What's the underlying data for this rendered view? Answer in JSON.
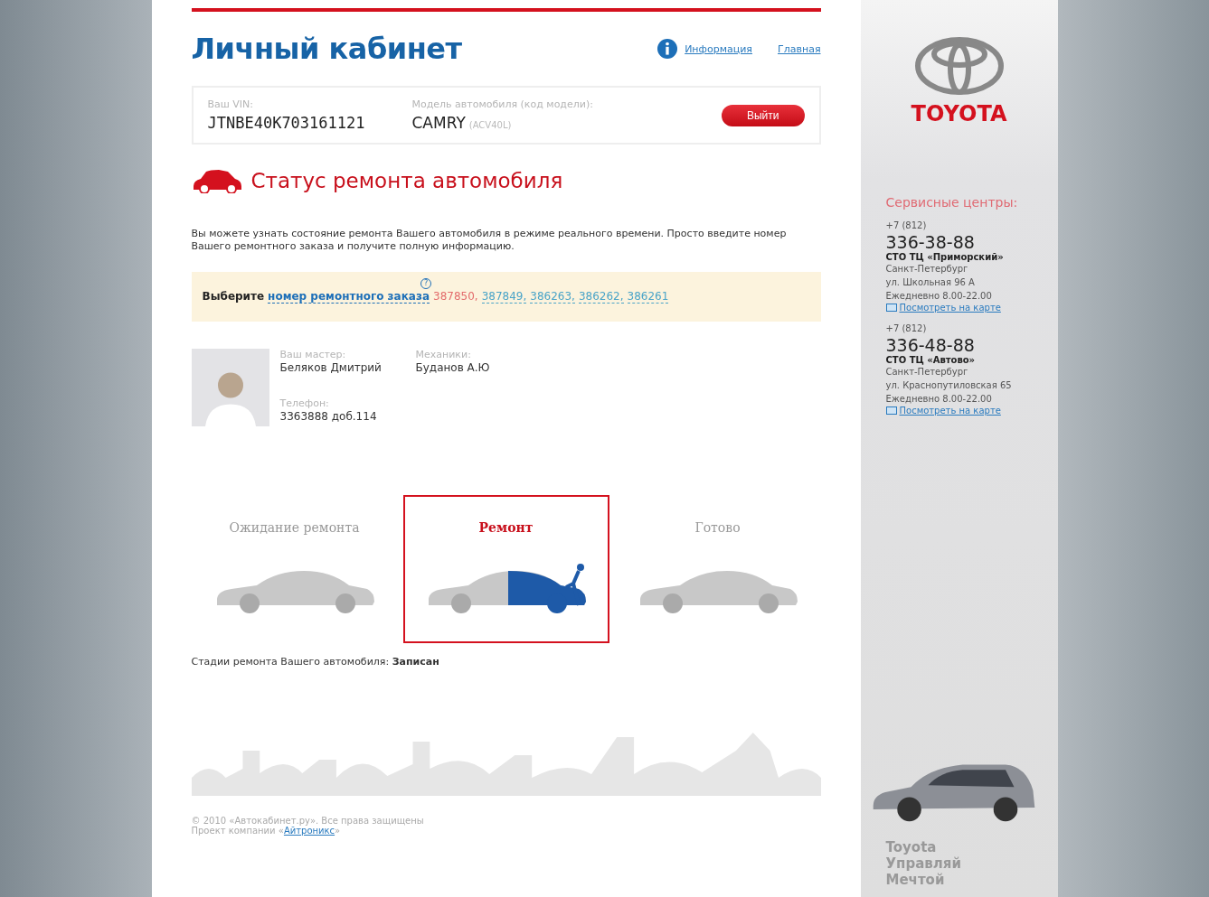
{
  "header": {
    "title": "Личный кабинет",
    "links": [
      {
        "kind": "info",
        "label": "Информация"
      },
      {
        "kind": "plain",
        "label": "Главная"
      }
    ]
  },
  "vehicle": {
    "vin_label": "Ваш VIN:",
    "vin": "JTNBE40K703161121",
    "model_label": "Модель автомобиля (код модели):",
    "model": "CAMRY",
    "model_code": "(ACV40L)",
    "logout_button": "Выйти"
  },
  "section_title": "Статус ремонта автомобиля",
  "description": "Вы можете узнать состояние ремонта Вашего автомобиля в режиме реального времени. Просто введите номер Вашего ремонтного заказа и получите полную информацию.",
  "order_selector": {
    "label": "Выберите",
    "link": "номер ремонтного заказа",
    "help": "?",
    "orders": [
      {
        "number": "387850,",
        "selected": true
      },
      {
        "number": "387849,",
        "selected": false
      },
      {
        "number": "386263,",
        "selected": false
      },
      {
        "number": "386262,",
        "selected": false
      },
      {
        "number": "386261",
        "selected": false
      }
    ]
  },
  "staff": {
    "master_label": "Ваш мастер:",
    "master": "Беляков Дмитрий",
    "mechanic_label": "Механики:",
    "mechanic": "Буданов А.Ю",
    "phone_label": "Телефон:",
    "phone": "3363888 доб.114"
  },
  "stages": [
    {
      "kind": "waiting",
      "label": "Ожидание ремонта",
      "selected": false
    },
    {
      "kind": "repair",
      "label": "Ремонт",
      "selected": true
    },
    {
      "kind": "done",
      "label": "Готово",
      "selected": false
    }
  ],
  "stage_status": {
    "label": "Стадии ремонта Вашего автомобиля:",
    "value": "Записан"
  },
  "footer": {
    "copyright": "© 2010 «Автокабинет.ру». Все права защищены",
    "project_prefix": "Проект компании «",
    "project_link": "Айтроникс",
    "project_suffix": "»"
  },
  "sidebar": {
    "brand": "TOYOTA",
    "service_title": "Сервисные центры:",
    "centers": [
      {
        "code": "+7 (812)",
        "phone": "336-38-88",
        "name": "СТО ТЦ «Приморский»",
        "city": "Санкт-Петербург",
        "street": "ул. Школьная 96 А",
        "hours": "Ежедневно 8.00-22.00",
        "map_link": "Посмотреть на карте"
      },
      {
        "code": "+7 (812)",
        "phone": "336-48-88",
        "name": "СТО ТЦ «Автово»",
        "city": "Санкт-Петербург",
        "street": "ул. Краснопутиловская 65",
        "hours": "Ежедневно 8.00-22.00",
        "map_link": "Посмотреть на карте"
      }
    ],
    "slogan": [
      "Toyota",
      "Управляй",
      "Мечтой"
    ]
  }
}
